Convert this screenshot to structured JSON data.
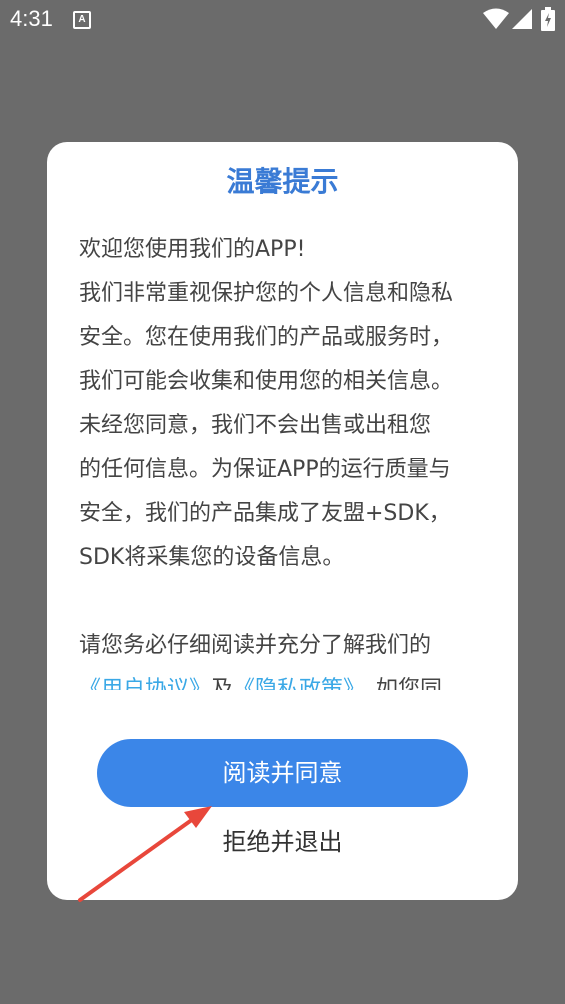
{
  "status_bar": {
    "time": "4:31",
    "notification_glyph": "A",
    "icons": [
      "wifi-icon",
      "signal-icon",
      "battery-icon"
    ]
  },
  "dialog": {
    "title": "温馨提示",
    "greeting": "欢迎您使用我们的APP!",
    "lines": [
      "我们非常重视保护您的个人信息和隐私",
      "安全。您在使用我们的产品或服务时，",
      "我们可能会收集和使用您的相关信息。",
      "未经您同意，我们不会出售或出租您",
      "的任何信息。为保证APP的运行质量与",
      "安全，我们的产品集成了友盟+SDK，",
      "SDK将采集您的设备信息。"
    ],
    "read_notice": "请您务必仔细阅读并充分了解我们的",
    "user_agreement_link": "《用户协议》",
    "and_text": "及",
    "privacy_policy_link": "《隐私政策》",
    "trailing_text": "，如您同",
    "agree_label": "阅读并同意",
    "reject_label": "拒绝并退出"
  },
  "colors": {
    "overlay": "#6b6b6b",
    "title": "#3a7bd5",
    "button": "#3b86e8",
    "link": "#3aa8e6",
    "annotation_arrow": "#e8473b"
  }
}
